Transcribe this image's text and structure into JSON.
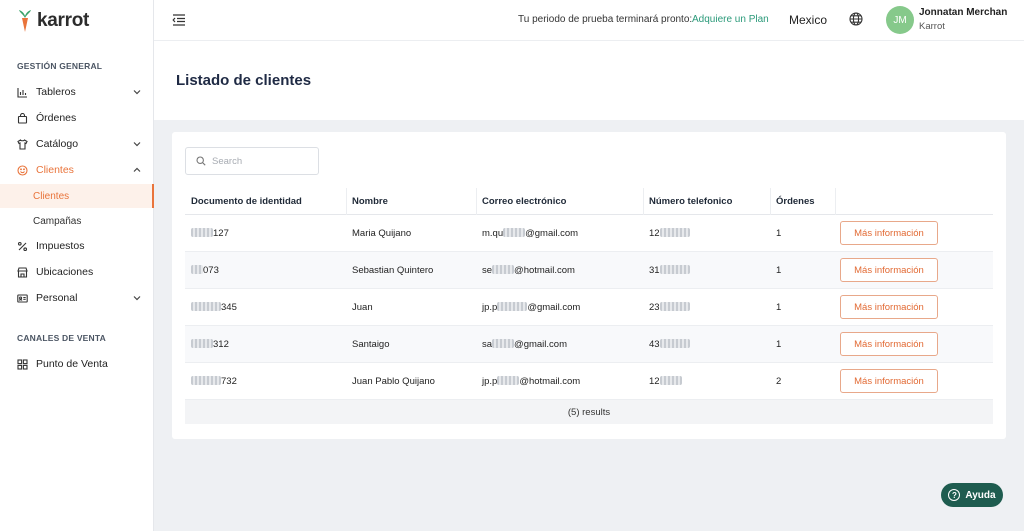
{
  "brand": {
    "name": "karrot"
  },
  "sidebar": {
    "section_general": "GESTIÓN GENERAL",
    "section_sales": "CANALES DE VENTA",
    "items": {
      "tableros": "Tableros",
      "ordenes": "Órdenes",
      "catalogo": "Catálogo",
      "clientes": "Clientes",
      "clientes_sub": "Clientes",
      "campanas": "Campañas",
      "impuestos": "Impuestos",
      "ubicaciones": "Ubicaciones",
      "personal": "Personal",
      "punto_venta": "Punto de Venta"
    }
  },
  "header": {
    "trial_text": "Tu periodo de prueba terminará pronto:",
    "trial_link": "Adquiere un Plan",
    "country": "Mexico",
    "user_initials": "JM",
    "user_name": "Jonnatan Merchan",
    "user_org": "Karrot"
  },
  "page": {
    "title": "Listado de clientes"
  },
  "search": {
    "placeholder": "Search",
    "value": ""
  },
  "table": {
    "columns": [
      "Documento de identidad",
      "Nombre",
      "Correo electrónico",
      "Número telefonico",
      "Órdenes"
    ],
    "action_label": "Más información",
    "rows": [
      {
        "doc_suffix": "127",
        "name": "Maria Quijano",
        "email_prefix": "m.qu",
        "email_suffix": "@gmail.com",
        "phone_prefix": "12",
        "orders": "1"
      },
      {
        "doc_suffix": "073",
        "name": "Sebastian Quintero",
        "email_prefix": "se",
        "email_suffix": "@hotmail.com",
        "phone_prefix": "31",
        "orders": "1"
      },
      {
        "doc_suffix": "345",
        "name": "Juan",
        "email_prefix": "jp.p",
        "email_suffix": "@gmail.com",
        "phone_prefix": "23",
        "orders": "1"
      },
      {
        "doc_suffix": "312",
        "name": "Santaigo",
        "email_prefix": "sa",
        "email_suffix": "@gmail.com",
        "phone_prefix": "43",
        "orders": "1"
      },
      {
        "doc_suffix": "732",
        "name": "Juan Pablo Quijano",
        "email_prefix": "jp.p",
        "email_suffix": "@hotmail.com",
        "phone_prefix": "12",
        "orders": "2"
      }
    ],
    "results": "(5) results"
  },
  "help": {
    "label": "Ayuda"
  },
  "colors": {
    "accent": "#e9743b",
    "link": "#2b9a7a",
    "help_bg": "#1e5c4f",
    "avatar_bg": "#86c98b"
  }
}
